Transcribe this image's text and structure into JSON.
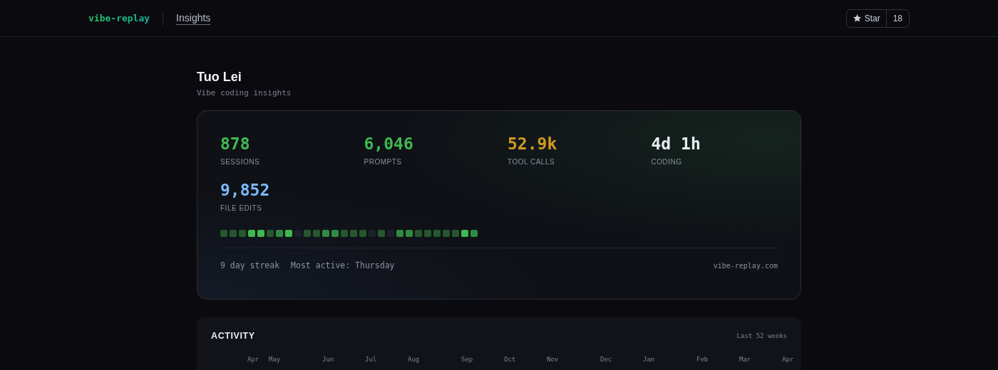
{
  "nav": {
    "brand": "vibe-replay",
    "link": "Insights",
    "star": {
      "label": "Star",
      "count": "18"
    }
  },
  "profile": {
    "name": "Tuo Lei",
    "subtitle": "Vibe coding insights"
  },
  "stats": [
    {
      "value": "878",
      "label": "SESSIONS",
      "color": "#3fb950"
    },
    {
      "value": "6,046",
      "label": "PROMPTS",
      "color": "#3fb950"
    },
    {
      "value": "52.9k",
      "label": "TOOL CALLS",
      "color": "#d29922"
    },
    {
      "value": "4d 1h",
      "label": "CODING",
      "color": "#e6edf3"
    },
    {
      "value": "9,852",
      "label": "FILE EDITS",
      "color": "#79b8ff"
    }
  ],
  "streak_days": [
    {
      "kind": "low"
    },
    {
      "kind": "low"
    },
    {
      "kind": "low"
    },
    {
      "kind": "high"
    },
    {
      "kind": "high"
    },
    {
      "kind": "low"
    },
    {
      "kind": "mid"
    },
    {
      "kind": "high"
    },
    {
      "kind": "none"
    },
    {
      "kind": "low"
    },
    {
      "kind": "low"
    },
    {
      "kind": "mid"
    },
    {
      "kind": "mid"
    },
    {
      "kind": "low"
    },
    {
      "kind": "low"
    },
    {
      "kind": "low"
    },
    {
      "kind": "none"
    },
    {
      "kind": "low"
    },
    {
      "kind": "none"
    },
    {
      "kind": "mid"
    },
    {
      "kind": "mid"
    },
    {
      "kind": "low"
    },
    {
      "kind": "low"
    },
    {
      "kind": "low"
    },
    {
      "kind": "low"
    },
    {
      "kind": "low"
    },
    {
      "kind": "high"
    },
    {
      "kind": "mid"
    }
  ],
  "footer": {
    "streak": "9 day streak",
    "most_active": "Most active: Thursday",
    "site": "vibe-replay.com"
  },
  "activity": {
    "title": "ACTIVITY",
    "range": "Last 52 weeks",
    "months": [
      "Apr",
      "May",
      "Jun",
      "Jul",
      "Aug",
      "Sep",
      "Oct",
      "Nov",
      "Dec",
      "Jan",
      "Feb",
      "Mar",
      "Apr"
    ]
  }
}
